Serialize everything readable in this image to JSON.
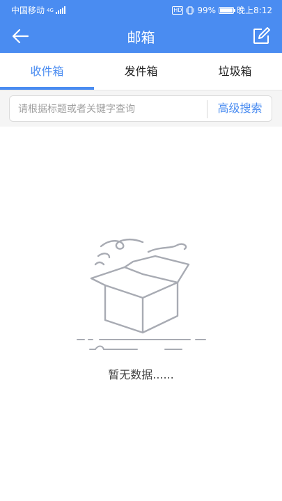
{
  "status_bar": {
    "carrier": "中国移动",
    "network": "4G",
    "battery": "99%",
    "battery_level": 0.99,
    "time": "晚上8:12",
    "hd_badge": "HD"
  },
  "header": {
    "title": "邮箱",
    "back_icon": "arrow-left-icon",
    "edit_icon": "edit-icon"
  },
  "tabs": [
    {
      "label": "收件箱",
      "active": true
    },
    {
      "label": "发件箱",
      "active": false
    },
    {
      "label": "垃圾箱",
      "active": false
    }
  ],
  "search": {
    "placeholder": "请根据标题或者关键字查询",
    "advanced_label": "高级搜索"
  },
  "empty_state": {
    "icon": "empty-box-icon",
    "text": "暂无数据......"
  },
  "colors": {
    "primary": "#4a8cf1",
    "background": "#ffffff",
    "search_area": "#f5f5f5"
  }
}
